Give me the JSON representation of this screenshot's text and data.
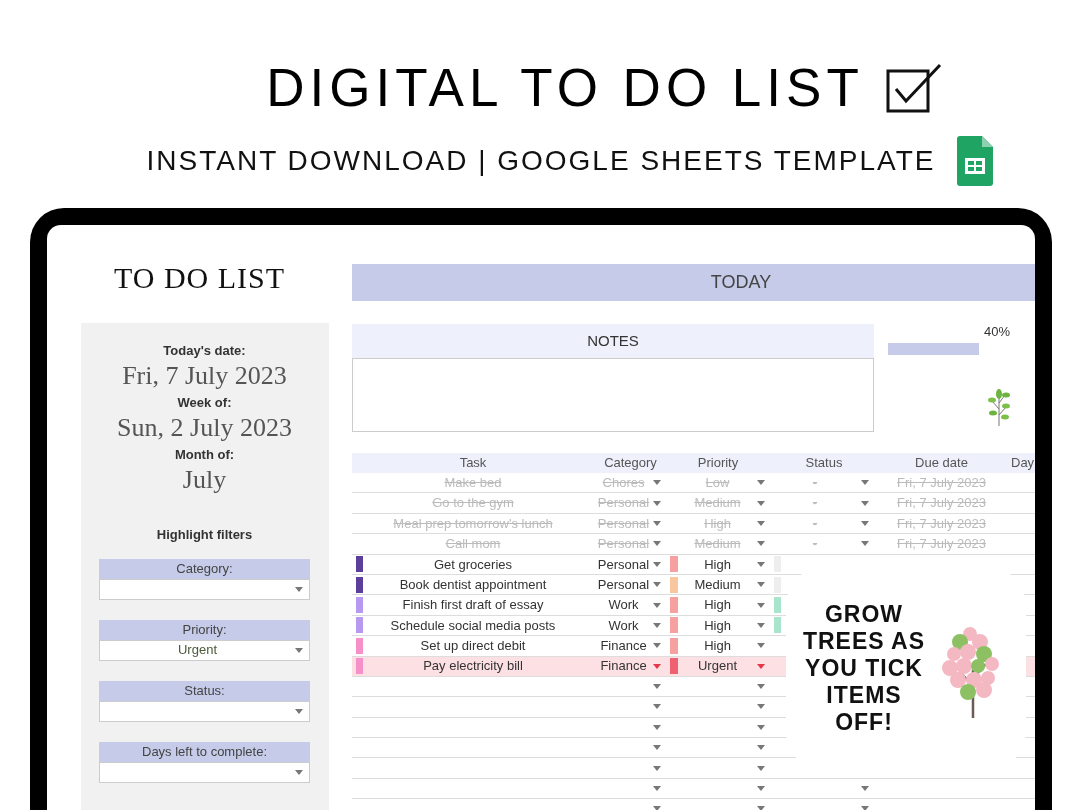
{
  "heading": {
    "title": "DIGITAL TO DO LIST",
    "subtitle": "INSTANT DOWNLOAD | GOOGLE SHEETS TEMPLATE"
  },
  "sheet": {
    "title": "TO DO LIST",
    "dates": [
      {
        "label": "Today's date:",
        "value": "Fri, 7 July 2023"
      },
      {
        "label": "Week of:",
        "value": "Sun, 2 July 2023"
      },
      {
        "label": "Month of:",
        "value": "July"
      }
    ],
    "filters_title": "Highlight filters",
    "filters": [
      {
        "label": "Category:"
      },
      {
        "label": "Priority:",
        "value": "Urgent"
      },
      {
        "label": "Status:"
      },
      {
        "label": "Days left to complete:"
      }
    ],
    "banner": "TODAY",
    "notes_title": "NOTES",
    "progress": {
      "reading": "40%",
      "level": 0.4
    },
    "table": {
      "columns": [
        "Task",
        "Category",
        "Priority",
        "Status",
        "Due date",
        "Day"
      ],
      "rows": [
        {
          "kind": "task",
          "done": true,
          "highlighted": false,
          "task": "Make bed",
          "category": "Chores",
          "priority": "Low",
          "status": "-",
          "due": "Fri, 7 July 2023"
        },
        {
          "kind": "task",
          "done": true,
          "highlighted": false,
          "task": "Go to the gym",
          "category": "Personal",
          "priority": "Medium",
          "status": "-",
          "due": "Fri, 7 July 2023"
        },
        {
          "kind": "task",
          "done": true,
          "highlighted": false,
          "task": "Meal prep tomorrow's lunch",
          "category": "Personal",
          "priority": "High",
          "status": "-",
          "due": "Fri, 7 July 2023"
        },
        {
          "kind": "task",
          "done": true,
          "highlighted": false,
          "task": "Call mom",
          "category": "Personal",
          "priority": "Medium",
          "status": "-",
          "due": "Fri, 7 July 2023"
        },
        {
          "kind": "task",
          "done": false,
          "highlighted": false,
          "task": "Get groceries",
          "category": "Personal",
          "priority": "High",
          "color": "#5b3f9a",
          "priority_marker": {
            "color": "#f7a0a0"
          },
          "status_marker": {
            "color": "#eeeeee"
          }
        },
        {
          "kind": "task",
          "done": false,
          "highlighted": false,
          "task": "Book dentist appointment",
          "category": "Personal",
          "priority": "Medium",
          "color": "#5b3f9a",
          "priority_marker": {
            "color": "#f8c7a0"
          },
          "status_marker": {
            "color": "#eeeeee"
          }
        },
        {
          "kind": "task",
          "done": false,
          "highlighted": false,
          "task": "Finish first draft of essay",
          "category": "Work",
          "priority": "High",
          "color": "#b79af0",
          "priority_marker": {
            "color": "#f7a0a0"
          },
          "status_marker": {
            "color": "#a9e5cc"
          }
        },
        {
          "kind": "task",
          "done": false,
          "highlighted": false,
          "task": "Schedule social media posts",
          "category": "Work",
          "priority": "High",
          "color": "#b79af0",
          "priority_marker": {
            "color": "#f7a0a0"
          },
          "status_marker": {
            "color": "#a9e5cc"
          }
        },
        {
          "kind": "task",
          "done": false,
          "highlighted": false,
          "task": "Set up direct debit",
          "category": "Finance",
          "priority": "High",
          "color": "#f78fc8",
          "priority_marker": {
            "color": "#f7a0a0"
          }
        },
        {
          "kind": "task",
          "done": false,
          "highlighted": true,
          "task": "Pay electricity bill",
          "category": "Finance",
          "priority": "Urgent",
          "color": "#f78fc8",
          "priority_marker": {
            "color": "#ef6070"
          }
        },
        {
          "kind": "empty"
        },
        {
          "kind": "empty"
        },
        {
          "kind": "empty"
        },
        {
          "kind": "empty"
        },
        {
          "kind": "empty"
        },
        {
          "kind": "empty"
        },
        {
          "kind": "empty"
        }
      ]
    }
  },
  "callout": {
    "text": "GROW TREES AS YOU TICK ITEMS OFF!"
  }
}
